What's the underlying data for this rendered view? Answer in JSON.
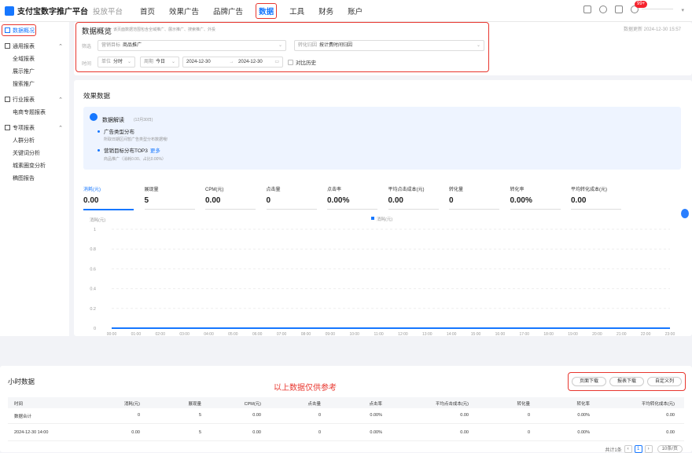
{
  "topbar": {
    "brand": "支付宝数字推广平台",
    "sub": "投放平台",
    "nav": [
      "首页",
      "效果广告",
      "品牌广告",
      "数据",
      "工具",
      "财务",
      "账户"
    ],
    "active_nav": "数据",
    "badge": "99+"
  },
  "sidebar": {
    "items": [
      {
        "label": "数据概况",
        "type": "top",
        "active": true
      },
      {
        "label": "通用报表",
        "type": "group"
      },
      {
        "label": "全域报表",
        "type": "child"
      },
      {
        "label": "展示推广",
        "type": "child"
      },
      {
        "label": "搜索推广",
        "type": "child"
      },
      {
        "label": "行业报表",
        "type": "group"
      },
      {
        "label": "电商专题报表",
        "type": "child"
      },
      {
        "label": "专项报表",
        "type": "group"
      },
      {
        "label": "人群分析",
        "type": "child"
      },
      {
        "label": "关键词分析",
        "type": "child"
      },
      {
        "label": "城素圈变分析",
        "type": "child"
      },
      {
        "label": "稿图报告",
        "type": "child"
      }
    ]
  },
  "overview": {
    "title": "数据概览",
    "desc": "该页面数据范围包含全域推广、展示推广、搜索推广、外投",
    "update_time": "数据更新 2024-12-30 15:57",
    "row1_label": "筛选",
    "goal_label": "营销目标",
    "goal_value": "商品推广",
    "conv_label": "转化归因",
    "conv_value": "按计费时间归因",
    "row2_label": "时间",
    "unit_label": "单位",
    "unit_value": "分时",
    "period_label": "周期",
    "period_value": "今日",
    "date_start": "2024-12-30",
    "date_sep": "→",
    "date_end": "2024-12-30",
    "compare_label": "对比历史"
  },
  "effect": {
    "title": "效果数据",
    "interp_title": "数据解读",
    "interp_date": "(12月30日)",
    "bullet1": "广告类型分布",
    "note1": "所取日期区间暂广告类型分布数据哦!",
    "bullet2": "营销目标分布TOP3",
    "more": "更多",
    "note2": "商品推广（消耗0.00、占比0.00%）",
    "metrics": [
      {
        "label": "消耗(元)",
        "value": "0.00",
        "active": true
      },
      {
        "label": "展现量",
        "value": "5"
      },
      {
        "label": "CPM(元)",
        "value": "0.00"
      },
      {
        "label": "点击量",
        "value": "0"
      },
      {
        "label": "点击率",
        "value": "0.00%"
      },
      {
        "label": "平均点击成本(元)",
        "value": "0.00"
      },
      {
        "label": "转化量",
        "value": "0"
      },
      {
        "label": "转化率",
        "value": "0.00%"
      },
      {
        "label": "平均转化成本(元)",
        "value": "0.00"
      }
    ]
  },
  "chart_data": {
    "type": "line",
    "ylabel": "消耗(元)",
    "legend": "消耗(元)",
    "legend_position": "top",
    "ylim": [
      0,
      1
    ],
    "yticks": [
      "1",
      "0.8",
      "0.6",
      "0.4",
      "0.2",
      "0"
    ],
    "x": [
      "00:00",
      "01:00",
      "02:00",
      "03:00",
      "04:00",
      "05:00",
      "06:00",
      "07:00",
      "08:00",
      "09:00",
      "10:00",
      "11:00",
      "12:00",
      "13:00",
      "14:00",
      "15:00",
      "16:00",
      "17:00",
      "18:00",
      "19:00",
      "20:00",
      "21:00",
      "22:00",
      "23:00"
    ],
    "series": [
      {
        "name": "消耗(元)",
        "values": [
          0,
          0,
          0,
          0,
          0,
          0,
          0,
          0,
          0,
          0,
          0,
          0,
          0,
          0,
          0,
          0,
          0,
          0,
          0,
          0,
          0,
          0,
          0,
          0
        ],
        "color": "#1677ff"
      }
    ],
    "grid": true
  },
  "hourly": {
    "title": "小时数据",
    "note": "以上数据仅供参考",
    "buttons": [
      "页面下载",
      "报表下载",
      "自定义列"
    ],
    "columns": [
      "时间",
      "消耗(元)",
      "展现量",
      "CPM(元)",
      "点击量",
      "点击率",
      "平均点击成本(元)",
      "转化量",
      "转化率",
      "平均转化成本(元)"
    ],
    "rows": [
      [
        "数据合计",
        "0",
        "5",
        "0.00",
        "0",
        "0.00%",
        "0.00",
        "0",
        "0.00%",
        "0.00"
      ],
      [
        "2024-12-30 14:00",
        "0.00",
        "5",
        "0.00",
        "0",
        "0.00%",
        "0.00",
        "0",
        "0.00%",
        "0.00"
      ]
    ],
    "pager_total": "共计1条",
    "page": "1",
    "page_size": "10条/页"
  }
}
